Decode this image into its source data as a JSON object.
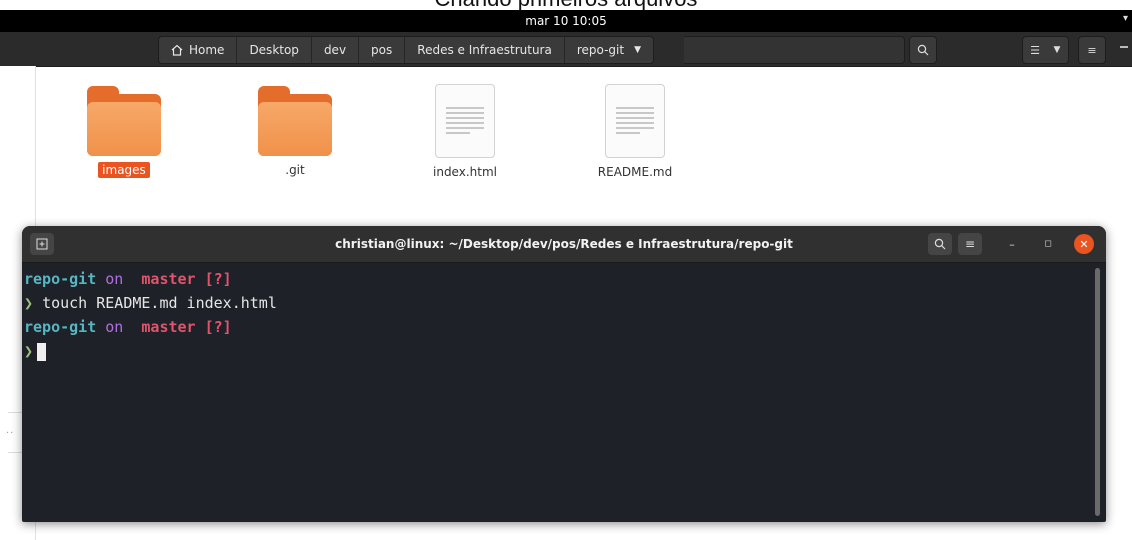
{
  "caption": "Criando primeiros arquivos",
  "topbar": {
    "clock": "mar 10  10:05"
  },
  "pathbar": {
    "crumbs": [
      "Home",
      "Desktop",
      "dev",
      "pos",
      "Redes e Infraestrutura",
      "repo-git"
    ]
  },
  "files": [
    {
      "name": "images",
      "type": "folder",
      "selected": true
    },
    {
      "name": ".git",
      "type": "folder",
      "selected": false
    },
    {
      "name": "index.html",
      "type": "document",
      "selected": false
    },
    {
      "name": "README.md",
      "type": "document",
      "selected": false
    }
  ],
  "terminal": {
    "title": "christian@linux: ~/Desktop/dev/pos/Redes e Infraestrutura/repo-git",
    "prompt": {
      "dir": "repo-git",
      "on": "on",
      "branch_icon": "",
      "branch": "master",
      "status": "[?]",
      "arrow": "❯"
    },
    "command": "touch README.md index.html"
  },
  "colors": {
    "accent": "#e95420",
    "folder": "#f0914a",
    "terminal_bg": "#1e2127"
  }
}
